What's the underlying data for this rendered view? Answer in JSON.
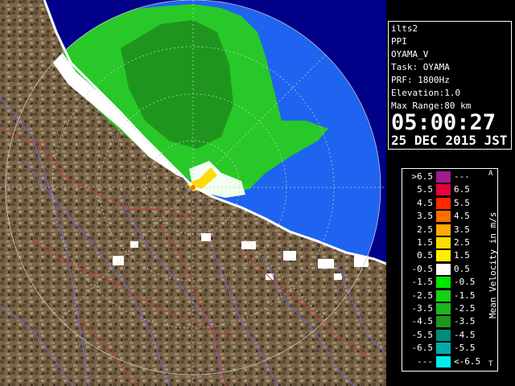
{
  "radar": {
    "colors": {
      "beyond": "#000088",
      "clear": "#1e64f0",
      "coast": "#ffffff",
      "rings": "#c8c8c8"
    }
  },
  "info": {
    "site": "ilts2",
    "mode": "PPI",
    "product": "OYAMA_V",
    "task": "Task: OYAMA",
    "prf": "PRF: 1800Hz",
    "elevation": "Elevation:1.0",
    "max_range": "Max Range:80 km",
    "time": "05:00:27",
    "date": "25 DEC 2015 JST"
  },
  "legend": {
    "title": "Mean Velocity in m/s",
    "top_marker": "A",
    "bottom_marker": "T",
    "rows": [
      {
        "lo": ">6.5",
        "hi": "---",
        "color": "#a01c8c"
      },
      {
        "lo": "5.5",
        "hi": "6.5",
        "color": "#e6003c"
      },
      {
        "lo": "4.5",
        "hi": "5.5",
        "color": "#ff2800"
      },
      {
        "lo": "3.5",
        "hi": "4.5",
        "color": "#ff6e00"
      },
      {
        "lo": "2.5",
        "hi": "3.5",
        "color": "#ffaa00"
      },
      {
        "lo": "1.5",
        "hi": "2.5",
        "color": "#ffdc00"
      },
      {
        "lo": "0.5",
        "hi": "1.5",
        "color": "#fff000"
      },
      {
        "lo": "-0.5",
        "hi": "0.5",
        "color": "#ffffff"
      },
      {
        "lo": "-1.5",
        "hi": "-0.5",
        "color": "#00e600"
      },
      {
        "lo": "-2.5",
        "hi": "-1.5",
        "color": "#14d214"
      },
      {
        "lo": "-3.5",
        "hi": "-2.5",
        "color": "#1eb41e"
      },
      {
        "lo": "-4.5",
        "hi": "-3.5",
        "color": "#1e961e"
      },
      {
        "lo": "-5.5",
        "hi": "-4.5",
        "color": "#008c78"
      },
      {
        "lo": "-6.5",
        "hi": "-5.5",
        "color": "#00aaaa"
      },
      {
        "lo": "---",
        "hi": "<-6.5",
        "color": "#00eeee"
      }
    ]
  }
}
